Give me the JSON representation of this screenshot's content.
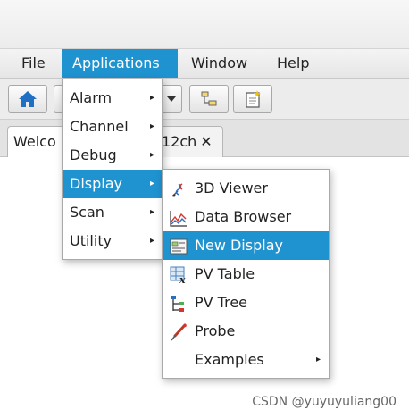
{
  "menubar": {
    "items": [
      "File",
      "Applications",
      "Window",
      "Help"
    ],
    "active": "Applications"
  },
  "toolbar": {
    "icons": [
      "home-icon",
      "hierarchy-icon",
      "new-display-icon"
    ]
  },
  "tabs": [
    {
      "label": "Welco",
      "close": ""
    },
    {
      "label": "12ch",
      "close": "✕"
    }
  ],
  "applications_menu": {
    "items": [
      {
        "label": "Alarm",
        "arrow": "▸"
      },
      {
        "label": "Channel",
        "arrow": "▸"
      },
      {
        "label": "Debug",
        "arrow": "▸"
      },
      {
        "label": "Display",
        "arrow": "▸"
      },
      {
        "label": "Scan",
        "arrow": "▸"
      },
      {
        "label": "Utility",
        "arrow": "▸"
      }
    ],
    "highlighted": "Display"
  },
  "display_menu": {
    "items": [
      {
        "label": "3D Viewer",
        "icon": "3d-viewer-icon"
      },
      {
        "label": "Data Browser",
        "icon": "data-browser-icon"
      },
      {
        "label": "New Display",
        "icon": "new-display-icon"
      },
      {
        "label": "PV Table",
        "icon": "pv-table-icon"
      },
      {
        "label": "PV Tree",
        "icon": "pv-tree-icon"
      },
      {
        "label": "Probe",
        "icon": "probe-icon"
      },
      {
        "label": "Examples",
        "icon": "",
        "arrow": "▸"
      }
    ],
    "highlighted": "New Display"
  },
  "watermark": "CSDN @yuyuyuliang00",
  "colors": {
    "accent": "#1f93d0",
    "popup_bg": "#ffffff",
    "toolbar_bg": "#ececec"
  }
}
